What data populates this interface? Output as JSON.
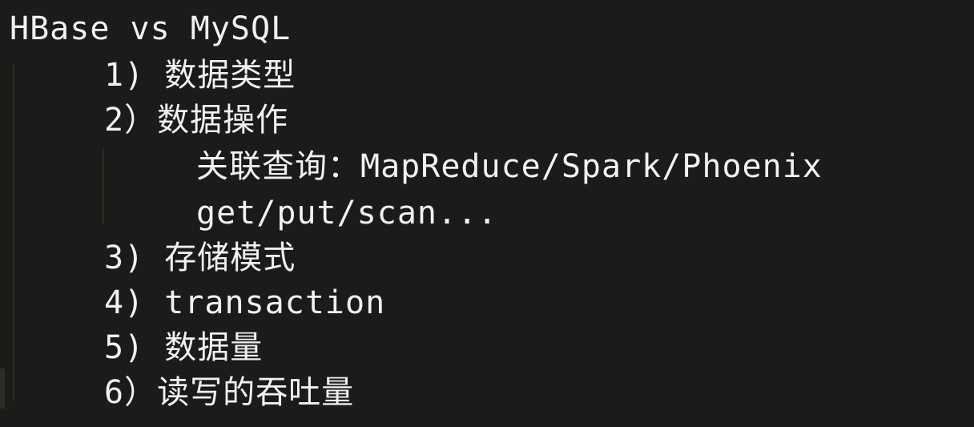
{
  "editor": {
    "lines": [
      "HBase vs MySQL",
      "1) 数据类型",
      "2）数据操作",
      "关联查询：MapReduce/Spark/Phoenix",
      "get/put/scan...",
      "3) 存储模式",
      "4) transaction",
      "5) 数据量",
      "6）读写的吞吐量"
    ]
  }
}
